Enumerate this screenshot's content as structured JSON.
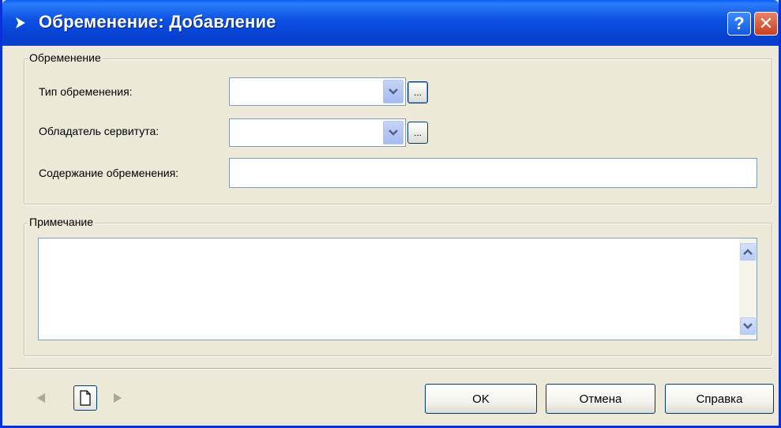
{
  "window": {
    "title": "Обременение: Добавление",
    "help_button": "?",
    "close_button": "✕"
  },
  "encumbrance_group": {
    "legend": "Обременение",
    "type_label": "Тип обременения:",
    "type_value": "",
    "holder_label": "Обладатель сервитута:",
    "holder_value": "",
    "content_label": "Содержание обременения:",
    "content_value": "",
    "browse_label": "..."
  },
  "note_group": {
    "legend": "Примечание",
    "text": ""
  },
  "buttons": {
    "ok": "OK",
    "cancel": "Отмена",
    "help": "Справка"
  },
  "icons": {
    "title": "arrow-icon",
    "prev": "prev-arrow-icon",
    "next": "next-arrow-icon",
    "page": "page-icon",
    "dropdown": "chevron-down-icon"
  },
  "colors": {
    "titlebar": "#0b4fe3",
    "face": "#ece9d8",
    "field_border": "#7f9db9"
  }
}
